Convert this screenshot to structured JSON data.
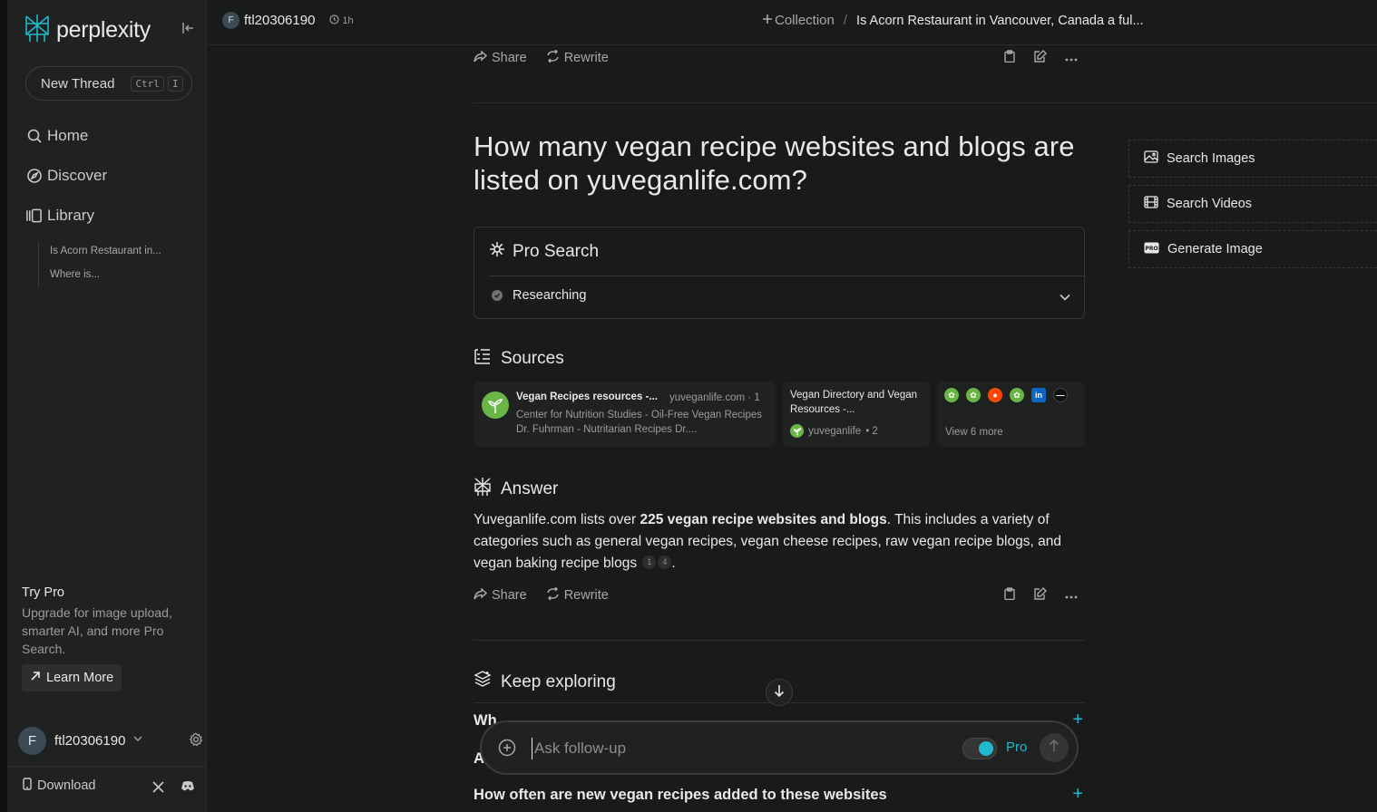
{
  "sidebar": {
    "logo_text": "perplexity",
    "new_thread_label": "New Thread",
    "shortcut_keys": [
      "Ctrl",
      "I"
    ],
    "nav": [
      {
        "label": "Home",
        "icon": "search-icon"
      },
      {
        "label": "Discover",
        "icon": "compass-icon"
      },
      {
        "label": "Library",
        "icon": "library-icon"
      }
    ],
    "library_items": [
      "Is Acorn Restaurant in...",
      "Where is..."
    ],
    "try_pro": {
      "title": "Try Pro",
      "description": "Upgrade for image upload, smarter AI, and more Pro Search.",
      "button_label": "Learn More"
    },
    "user": {
      "initial": "F",
      "name": "ftl20306190"
    },
    "download_label": "Download"
  },
  "topbar": {
    "user_initial": "F",
    "username": "ftl20306190",
    "time_ago": "1h",
    "collection_label": "Collection",
    "thread_title": "Is Acorn Restaurant in Vancouver, Canada a ful..."
  },
  "actions": {
    "share_label": "Share",
    "rewrite_label": "Rewrite"
  },
  "question": "How many vegan recipe websites and blogs are listed on yuveganlife.com?",
  "pro_search": {
    "title": "Pro Search",
    "step_label": "Researching"
  },
  "sources": {
    "title": "Sources",
    "items": [
      {
        "title": "Vegan Recipes resources -...",
        "domain": "yuveganlife.com · 1",
        "snippet": "Center for Nutrition Studies - Oil-Free Vegan Recipes Dr. Fuhrman - Nutritarian Recipes Dr...."
      },
      {
        "title": "Vegan Directory and Vegan Resources -...",
        "domain": "yuveganlife",
        "index": "• 2"
      }
    ],
    "view_more": "View 6 more"
  },
  "answer": {
    "title": "Answer",
    "text_before": "Yuveganlife.com lists over ",
    "text_bold": "225 vegan recipe websites and blogs",
    "text_after": ". This includes a variety of categories such as general vegan recipes, vegan cheese recipes, raw vegan recipe blogs, and vegan baking recipe blogs",
    "citations": [
      "1",
      "4"
    ],
    "text_end": "."
  },
  "side_actions": [
    {
      "label": "Search Images",
      "icon": "image-icon"
    },
    {
      "label": "Search Videos",
      "icon": "film-icon"
    },
    {
      "label": "Generate Image",
      "icon": "pro-badge-icon"
    }
  ],
  "keep_exploring": {
    "title": "Keep exploring",
    "items": [
      "Wh",
      "A",
      "How often are new vegan recipes added to these websites"
    ]
  },
  "followup": {
    "placeholder": "Ask follow-up",
    "pro_label": "Pro"
  },
  "colors": {
    "accent": "#20b8cd",
    "background": "#191a1a",
    "sidebar": "#202222",
    "leaf_green": "#69b545"
  }
}
